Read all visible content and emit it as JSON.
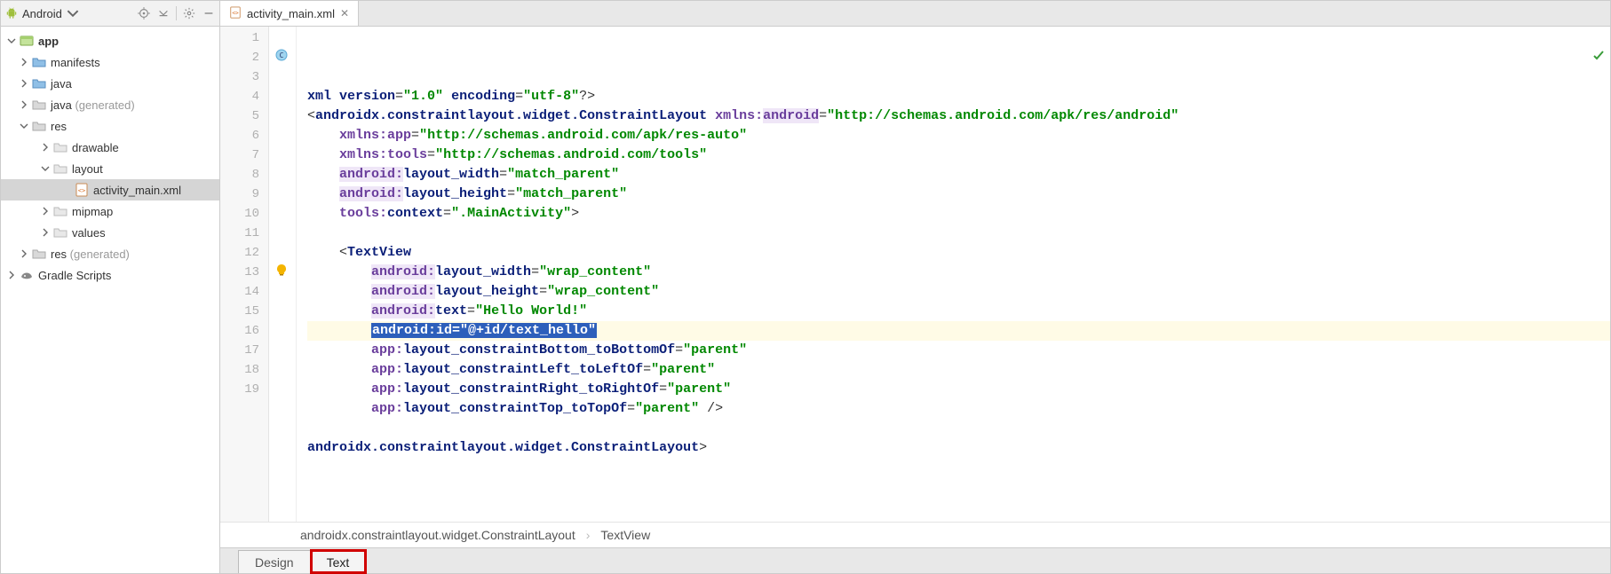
{
  "sidebar": {
    "title": "Android",
    "tree": [
      {
        "id": "app",
        "indent": 0,
        "label": "app",
        "bold": true,
        "arrow": "down",
        "icon": "module",
        "selected": false
      },
      {
        "id": "manifests",
        "indent": 1,
        "label": "manifests",
        "arrow": "right",
        "icon": "folder-open",
        "selected": false
      },
      {
        "id": "java",
        "indent": 1,
        "label": "java",
        "arrow": "right",
        "icon": "folder-open",
        "selected": false
      },
      {
        "id": "javagen",
        "indent": 1,
        "label": "java",
        "gen": "(generated)",
        "arrow": "right",
        "icon": "folder-gen",
        "selected": false
      },
      {
        "id": "res",
        "indent": 1,
        "label": "res",
        "arrow": "down",
        "icon": "folder-res",
        "selected": false
      },
      {
        "id": "drawable",
        "indent": 2,
        "label": "drawable",
        "arrow": "right",
        "icon": "folder-sub",
        "selected": false
      },
      {
        "id": "layout",
        "indent": 2,
        "label": "layout",
        "arrow": "down",
        "icon": "folder-sub",
        "selected": false
      },
      {
        "id": "activity",
        "indent": 3,
        "label": "activity_main.xml",
        "arrow": "",
        "icon": "xml-file",
        "selected": true
      },
      {
        "id": "mipmap",
        "indent": 2,
        "label": "mipmap",
        "arrow": "right",
        "icon": "folder-sub",
        "selected": false
      },
      {
        "id": "values",
        "indent": 2,
        "label": "values",
        "arrow": "right",
        "icon": "folder-sub",
        "selected": false
      },
      {
        "id": "resgen",
        "indent": 1,
        "label": "res",
        "gen": "(generated)",
        "arrow": "right",
        "icon": "folder-gen",
        "selected": false
      },
      {
        "id": "gradle",
        "indent": 0,
        "label": "Gradle Scripts",
        "arrow": "right",
        "icon": "gradle",
        "selected": false
      }
    ]
  },
  "tab": {
    "file": "activity_main.xml"
  },
  "lines": [
    "1",
    "2",
    "3",
    "4",
    "5",
    "6",
    "7",
    "8",
    "9",
    "10",
    "11",
    "12",
    "13",
    "14",
    "15",
    "16",
    "17",
    "18",
    "19"
  ],
  "code": {
    "l1": {
      "pre": "<?",
      "kw": "xml version",
      "eq": "=",
      "v1": "\"1.0\"",
      "sp": " ",
      "kw2": "encoding",
      "eq2": "=",
      "v2": "\"utf-8\"",
      "post": "?>"
    },
    "l2": {
      "open": "<",
      "tag": "androidx.constraintlayout.widget.ConstraintLayout",
      "sp": " ",
      "ns": "xmlns:",
      "nsn": "android",
      "eq": "=",
      "val": "\"http://schemas.android.com/apk/res/android\""
    },
    "l3": {
      "pad": "    ",
      "ns": "xmlns:",
      "nsn": "app",
      "eq": "=",
      "val": "\"http://schemas.android.com/apk/res-auto\""
    },
    "l4": {
      "pad": "    ",
      "ns": "xmlns:",
      "nsn": "tools",
      "eq": "=",
      "val": "\"http://schemas.android.com/tools\""
    },
    "l5": {
      "pad": "    ",
      "ns": "android:",
      "attr": "layout_width",
      "eq": "=",
      "val": "\"match_parent\""
    },
    "l6": {
      "pad": "    ",
      "ns": "android:",
      "attr": "layout_height",
      "eq": "=",
      "val": "\"match_parent\""
    },
    "l7": {
      "pad": "    ",
      "ns": "tools:",
      "attr": "context",
      "eq": "=",
      "val": "\".MainActivity\"",
      "end": ">"
    },
    "l9": {
      "pad": "    ",
      "open": "<",
      "tag": "TextView"
    },
    "l10": {
      "pad": "        ",
      "ns": "android:",
      "attr": "layout_width",
      "eq": "=",
      "val": "\"wrap_content\""
    },
    "l11": {
      "pad": "        ",
      "ns": "android:",
      "attr": "layout_height",
      "eq": "=",
      "val": "\"wrap_content\""
    },
    "l12": {
      "pad": "        ",
      "ns": "android:",
      "attr": "text",
      "eq": "=",
      "val": "\"Hello World!\""
    },
    "l13": {
      "pad": "        ",
      "sel": "android:id=\"@+id/text_hello\""
    },
    "l14": {
      "pad": "        ",
      "ns": "app:",
      "attr": "layout_constraintBottom_toBottomOf",
      "eq": "=",
      "val": "\"parent\""
    },
    "l15": {
      "pad": "        ",
      "ns": "app:",
      "attr": "layout_constraintLeft_toLeftOf",
      "eq": "=",
      "val": "\"parent\""
    },
    "l16": {
      "pad": "        ",
      "ns": "app:",
      "attr": "layout_constraintRight_toRightOf",
      "eq": "=",
      "val": "\"parent\""
    },
    "l17": {
      "pad": "        ",
      "ns": "app:",
      "attr": "layout_constraintTop_toTopOf",
      "eq": "=",
      "val": "\"parent\"",
      "end": " />"
    },
    "l19": {
      "open": "</",
      "tag": "androidx.constraintlayout.widget.ConstraintLayout",
      "end": ">"
    }
  },
  "breadcrumb": {
    "a": "androidx.constraintlayout.widget.ConstraintLayout",
    "b": "TextView"
  },
  "bottom": {
    "design": "Design",
    "text": "Text"
  }
}
